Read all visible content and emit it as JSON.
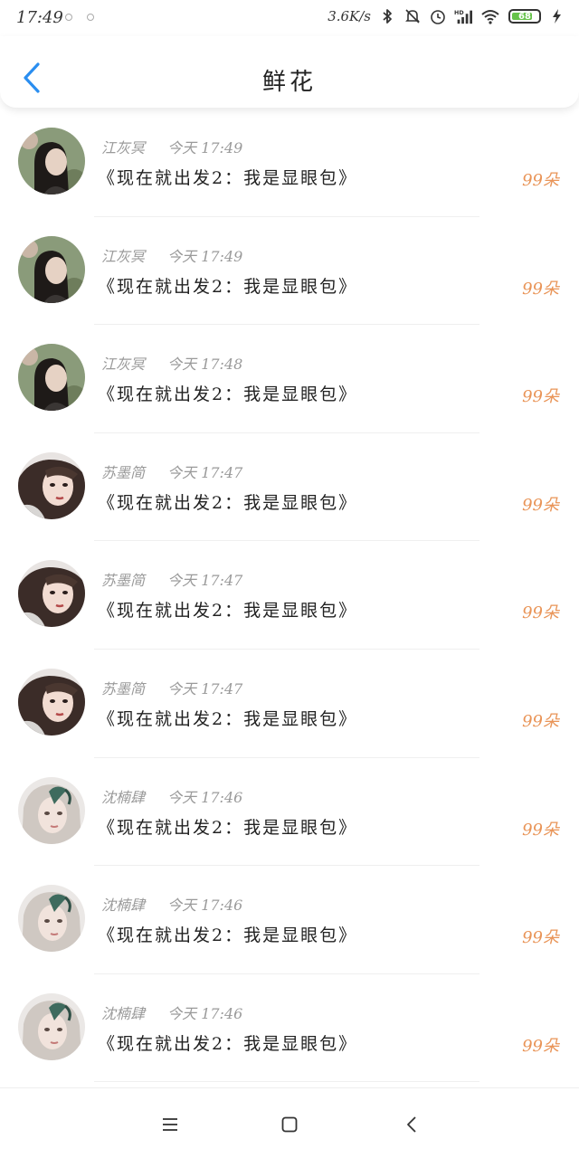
{
  "status_bar": {
    "time": "17:49",
    "speed": "3.6K/s",
    "battery": "68",
    "colors": {
      "battery": "#66c24a"
    },
    "icons": [
      "bluetooth-icon",
      "mute-icon",
      "alarm-icon",
      "signal-icon",
      "wifi-icon",
      "battery-icon",
      "charging-icon"
    ]
  },
  "header": {
    "title": "鲜花",
    "back_icon": "chevron-left-icon",
    "colors": {
      "back": "#2a8ef0"
    }
  },
  "colors": {
    "count": "#e99457",
    "meta": "#9a9a9a"
  },
  "rows": [
    {
      "name": "江灰冥",
      "time": "今天 17:49",
      "message": "《现在就出发2：我是显眼包》",
      "count": "99朵",
      "avatar": "avatar-a"
    },
    {
      "name": "江灰冥",
      "time": "今天 17:49",
      "message": "《现在就出发2：我是显眼包》",
      "count": "99朵",
      "avatar": "avatar-a"
    },
    {
      "name": "江灰冥",
      "time": "今天 17:48",
      "message": "《现在就出发2：我是显眼包》",
      "count": "99朵",
      "avatar": "avatar-a"
    },
    {
      "name": "苏墨简",
      "time": "今天 17:47",
      "message": "《现在就出发2：我是显眼包》",
      "count": "99朵",
      "avatar": "avatar-b"
    },
    {
      "name": "苏墨简",
      "time": "今天 17:47",
      "message": "《现在就出发2：我是显眼包》",
      "count": "99朵",
      "avatar": "avatar-b"
    },
    {
      "name": "苏墨简",
      "time": "今天 17:47",
      "message": "《现在就出发2：我是显眼包》",
      "count": "99朵",
      "avatar": "avatar-b"
    },
    {
      "name": "沈楠肆",
      "time": "今天 17:46",
      "message": "《现在就出发2：我是显眼包》",
      "count": "99朵",
      "avatar": "avatar-c"
    },
    {
      "name": "沈楠肆",
      "time": "今天 17:46",
      "message": "《现在就出发2：我是显眼包》",
      "count": "99朵",
      "avatar": "avatar-c"
    },
    {
      "name": "沈楠肆",
      "time": "今天 17:46",
      "message": "《现在就出发2：我是显眼包》",
      "count": "99朵",
      "avatar": "avatar-c"
    }
  ],
  "nav_bar": {
    "icons": [
      "menu-icon",
      "home-square-icon",
      "back-triangle-icon"
    ]
  }
}
